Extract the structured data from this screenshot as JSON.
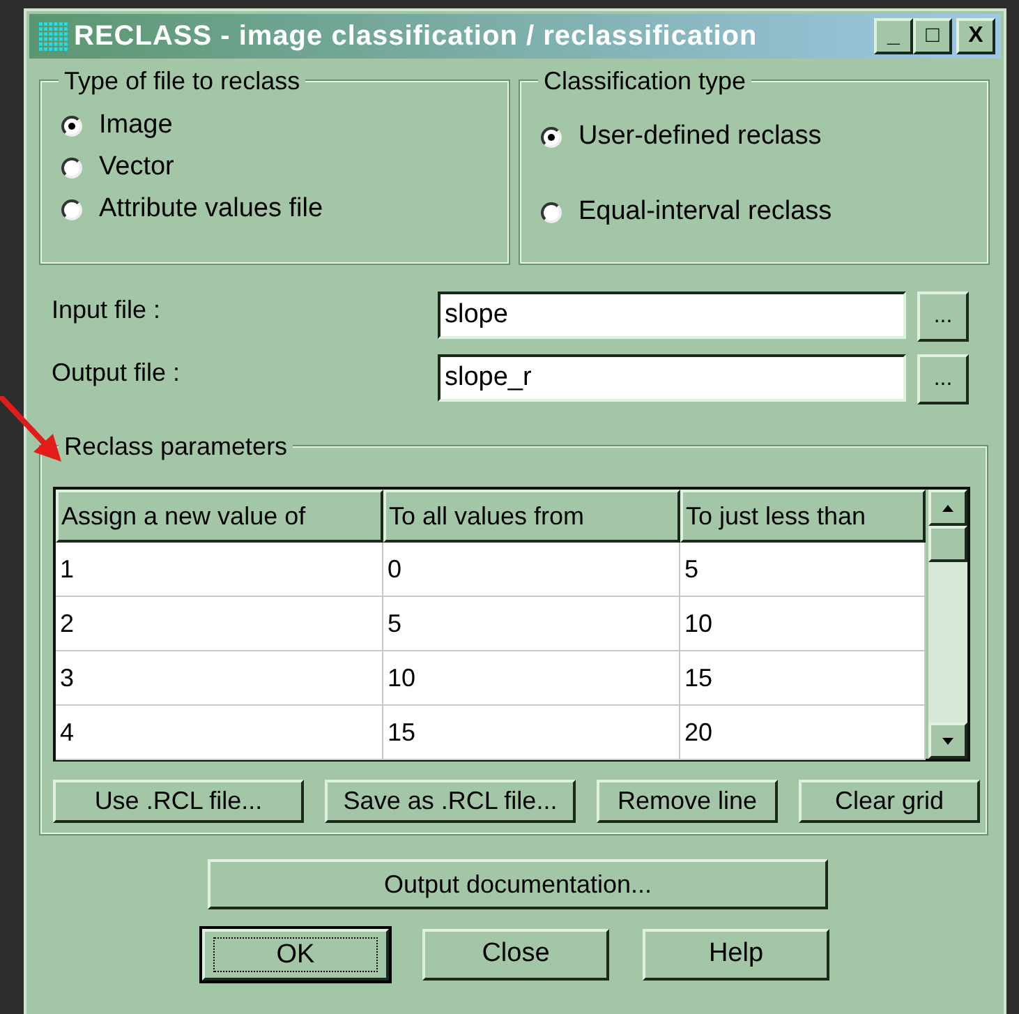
{
  "window": {
    "title": "RECLASS - image classification / reclassification",
    "controls": [
      "_",
      "□",
      "X"
    ]
  },
  "file_type": {
    "title": "Type of file to reclass",
    "options": [
      {
        "label": "Image",
        "selected": true
      },
      {
        "label": "Vector",
        "selected": false
      },
      {
        "label": "Attribute values file",
        "selected": false
      }
    ]
  },
  "classification_type": {
    "title": "Classification type",
    "options": [
      {
        "label": "User-defined reclass",
        "selected": true
      },
      {
        "label": "Equal-interval reclass",
        "selected": false
      }
    ]
  },
  "fields": [
    {
      "label": "Input file :",
      "value": "slope",
      "browse": "..."
    },
    {
      "label": "Output file :",
      "value": "slope_r",
      "browse": "..."
    }
  ],
  "reclass": {
    "title": "Reclass parameters",
    "columns": [
      "Assign a new value of",
      "To all values from",
      "To just less than"
    ],
    "rows": [
      [
        "1",
        "0",
        "5"
      ],
      [
        "2",
        "5",
        "10"
      ],
      [
        "3",
        "10",
        "15"
      ],
      [
        "4",
        "15",
        "20"
      ]
    ],
    "buttons": [
      "Use .RCL file...",
      "Save as .RCL file...",
      "Remove line",
      "Clear grid"
    ]
  },
  "doc_button": "Output documentation...",
  "buttons": [
    {
      "label": "OK",
      "focused": true
    },
    {
      "label": "Close",
      "focused": false
    },
    {
      "label": "Help",
      "focused": false
    }
  ]
}
